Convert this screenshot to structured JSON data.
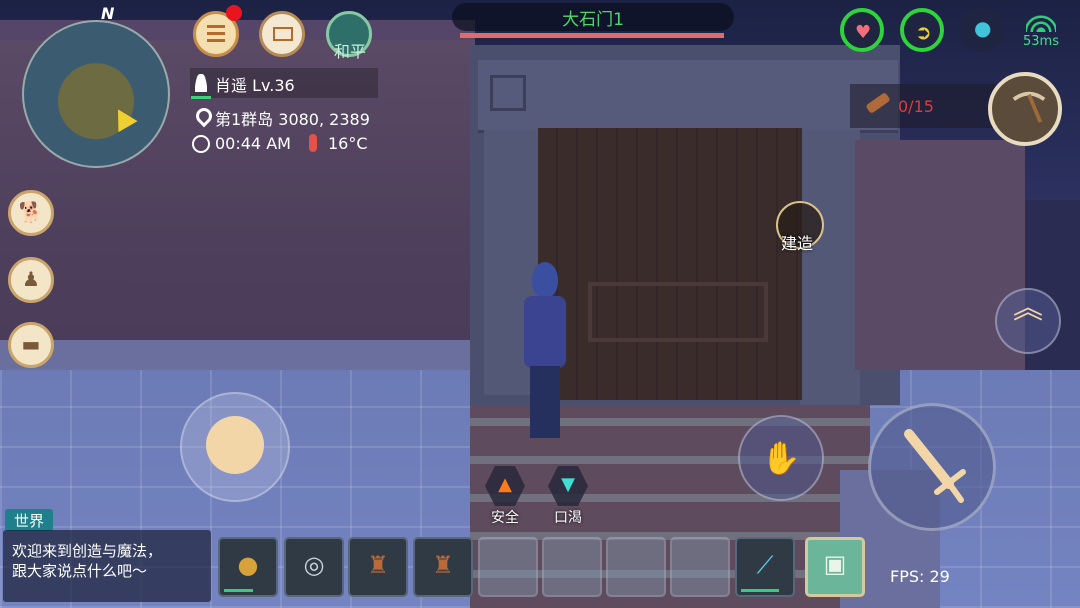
{
  "minimap": {
    "north_label": "N",
    "player_icon": "player-arrow-icon"
  },
  "top_bar": {
    "menu_icon": "menu-list-icon",
    "mail_icon": "mail-icon",
    "peace_label": "和平"
  },
  "player": {
    "name_level": "肖遥 Lv.36",
    "location": "第1群岛 3080, 2389",
    "time": "00:44 AM",
    "temperature": "16°C"
  },
  "target": {
    "name": "大石门1",
    "hp_fraction": 1.0
  },
  "stats": {
    "health_icon": "heart-icon",
    "food_icon": "food-icon",
    "water_icon": "water-drop-icon",
    "ping": "53ms"
  },
  "quest": {
    "count": "0/15",
    "item_icon": "wood-log-icon"
  },
  "tool": {
    "icon": "pickaxe-icon"
  },
  "build": {
    "label": "建造"
  },
  "side_buttons": {
    "pet_icon": "pet-icon",
    "emote_icon": "emote-icon",
    "chat_icon": "chat-bubble-icon"
  },
  "actions": {
    "jump_icon": "double-chevron-up-icon",
    "grab_icon": "hand-icon",
    "attack_icon": "sword-icon"
  },
  "status_effects": [
    {
      "label": "安全",
      "icon": "campfire-icon"
    },
    {
      "label": "口渴",
      "icon": "thirst-icon"
    }
  ],
  "chat": {
    "tab": "世界",
    "line1": "欢迎来到创造与魔法，",
    "line2": "跟大家说点什么吧～"
  },
  "hotbar": [
    {
      "icon": "gourd-icon",
      "durability": 0.6
    },
    {
      "icon": "disc-icon",
      "durability": 0
    },
    {
      "icon": "chair-icon",
      "durability": 0
    },
    {
      "icon": "chair-icon",
      "durability": 0
    },
    {
      "icon": "",
      "durability": 0
    },
    {
      "icon": "",
      "durability": 0
    },
    {
      "icon": "",
      "durability": 0
    },
    {
      "icon": "",
      "durability": 0
    },
    {
      "icon": "magic-staff-icon",
      "durability": 0.8
    }
  ],
  "bag": {
    "icon": "bag-icon"
  },
  "fps": "FPS: 29"
}
